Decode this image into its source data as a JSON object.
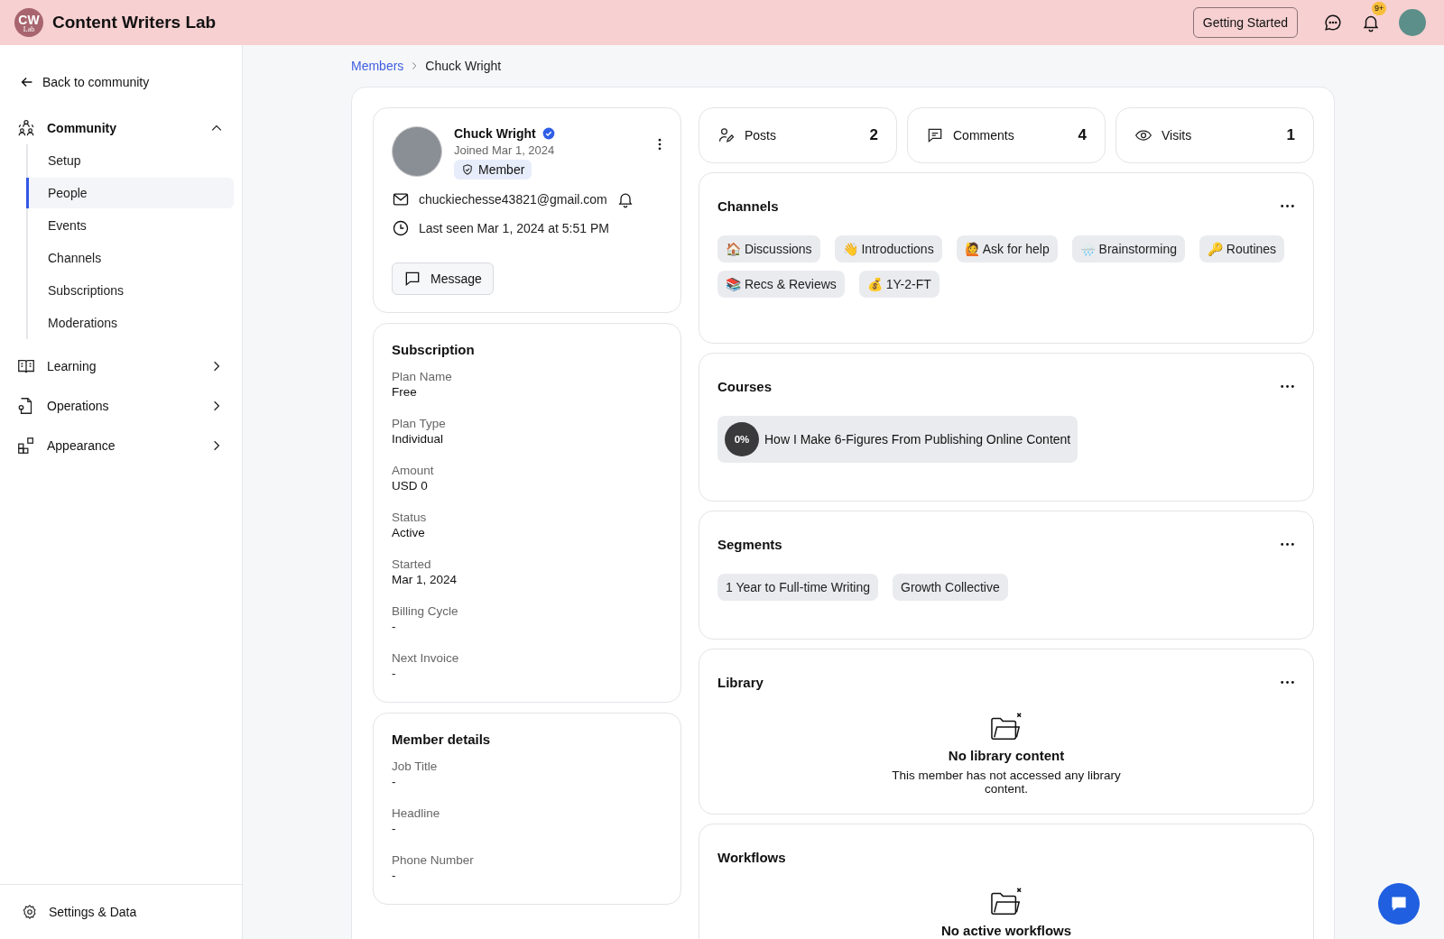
{
  "header": {
    "logo_text": "CW",
    "logo_sub": "Lab",
    "title": "Content Writers Lab",
    "getting_started": "Getting Started",
    "notification_badge": "9+"
  },
  "sidebar": {
    "back": "Back to community",
    "items": [
      {
        "label": "Community",
        "kind": "community",
        "expanded": true,
        "children": [
          {
            "label": "Setup",
            "selected": false
          },
          {
            "label": "People",
            "selected": true
          },
          {
            "label": "Events",
            "selected": false
          },
          {
            "label": "Channels",
            "selected": false
          },
          {
            "label": "Subscriptions",
            "selected": false
          },
          {
            "label": "Moderations",
            "selected": false
          }
        ]
      },
      {
        "label": "Learning",
        "kind": "learning",
        "expanded": false
      },
      {
        "label": "Operations",
        "kind": "operations",
        "expanded": false
      },
      {
        "label": "Appearance",
        "kind": "appearance",
        "expanded": false
      }
    ],
    "settings": "Settings & Data"
  },
  "breadcrumb": [
    "Members",
    "Chuck Wright"
  ],
  "profile": {
    "name": "Chuck Wright",
    "verified": true,
    "joined": "Joined Mar 1, 2024",
    "role": "Member",
    "email": "chuckiechesse43821@gmail.com",
    "last_seen": "Last seen Mar 1, 2024 at 5:51 PM",
    "message_button": "Message"
  },
  "subscription": {
    "title": "Subscription",
    "fields": [
      {
        "label": "Plan Name",
        "value": "Free"
      },
      {
        "label": "Plan Type",
        "value": "Individual"
      },
      {
        "label": "Amount",
        "value": "USD 0"
      },
      {
        "label": "Status",
        "value": "Active"
      },
      {
        "label": "Started",
        "value": "Mar 1, 2024"
      },
      {
        "label": "Billing Cycle",
        "value": "-"
      },
      {
        "label": "Next Invoice",
        "value": "-"
      }
    ]
  },
  "member_details": {
    "title": "Member details",
    "fields": [
      {
        "label": "Job Title",
        "value": "-"
      },
      {
        "label": "Headline",
        "value": "-"
      },
      {
        "label": "Phone Number",
        "value": "-"
      }
    ]
  },
  "stats": [
    {
      "kind": "posts",
      "label": "Posts",
      "value": "2"
    },
    {
      "kind": "comments",
      "label": "Comments",
      "value": "4"
    },
    {
      "kind": "visits",
      "label": "Visits",
      "value": "1"
    }
  ],
  "channels": {
    "title": "Channels",
    "items": [
      {
        "emoji": "🏠",
        "label": "Discussions"
      },
      {
        "emoji": "👋",
        "label": "Introductions"
      },
      {
        "emoji": "🙋",
        "label": "Ask for help"
      },
      {
        "emoji": "🌧️",
        "label": "Brainstorming"
      },
      {
        "emoji": "🔑",
        "label": "Routines"
      },
      {
        "emoji": "📚",
        "label": "Recs & Reviews"
      },
      {
        "emoji": "💰",
        "label": "1Y-2-FT"
      }
    ]
  },
  "courses": {
    "title": "Courses",
    "items": [
      {
        "progress": "0%",
        "title": "How I Make 6-Figures From Publishing Online Content"
      }
    ]
  },
  "segments": {
    "title": "Segments",
    "items": [
      "1 Year to Full-time Writing",
      "Growth Collective"
    ]
  },
  "library": {
    "title": "Library",
    "empty_title": "No library content",
    "empty_text": "This member has not accessed any library content."
  },
  "workflows": {
    "title": "Workflows",
    "empty_title": "No active workflows"
  }
}
